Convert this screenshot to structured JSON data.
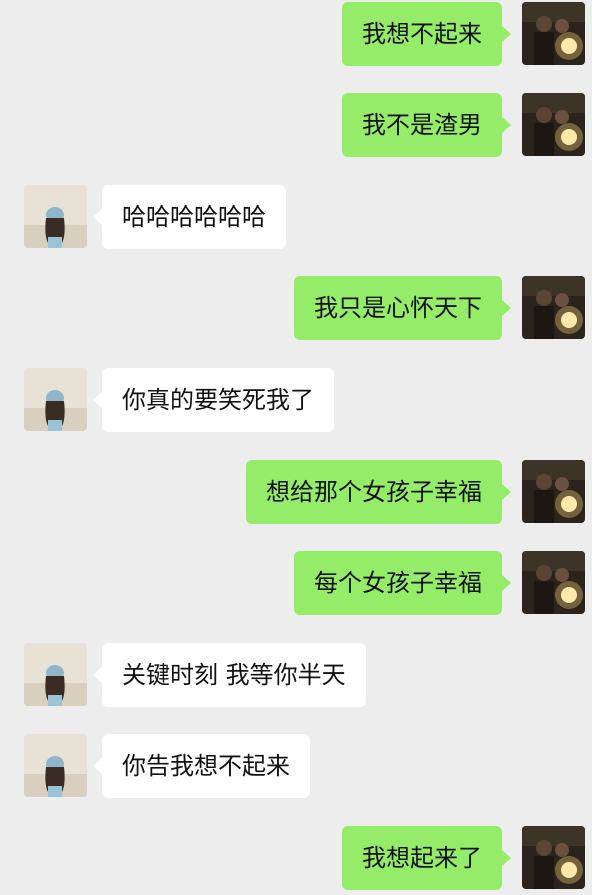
{
  "colors": {
    "background": "#ededed",
    "self_bubble": "#95ec69",
    "other_bubble": "#ffffff"
  },
  "avatars": {
    "self": "couple-sparkler-photo-avatar",
    "other": "girl-back-view-avatar"
  },
  "messages": [
    {
      "side": "right",
      "text": "我想不起来"
    },
    {
      "side": "right",
      "text": "我不是渣男"
    },
    {
      "side": "left",
      "text": "哈哈哈哈哈哈"
    },
    {
      "side": "right",
      "text": "我只是心怀天下"
    },
    {
      "side": "left",
      "text": "你真的要笑死我了"
    },
    {
      "side": "right",
      "text": "想给那个女孩子幸福"
    },
    {
      "side": "right",
      "text": "每个女孩子幸福"
    },
    {
      "side": "left",
      "text": "关键时刻 我等你半天"
    },
    {
      "side": "left",
      "text": "你告我想不起来"
    },
    {
      "side": "right",
      "text": "我想起来了"
    }
  ]
}
